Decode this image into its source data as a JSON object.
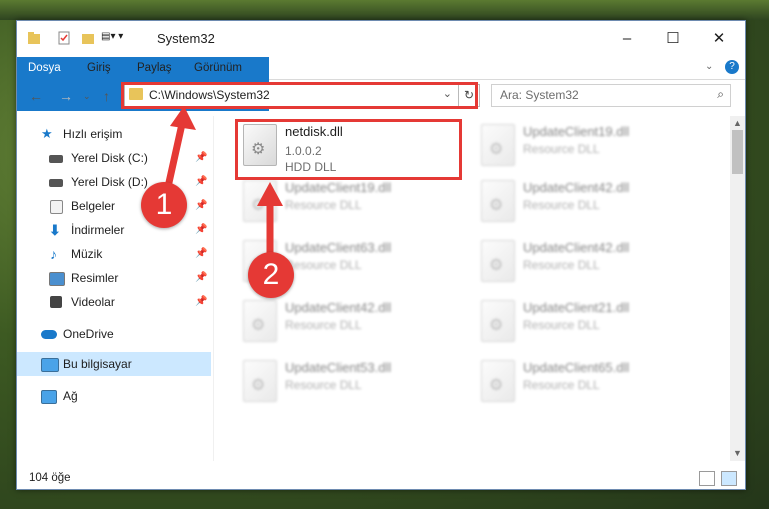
{
  "window": {
    "title": "System32"
  },
  "ribbon": {
    "tabs": [
      "Dosya",
      "Giriş",
      "Paylaş",
      "Görünüm"
    ]
  },
  "address": {
    "path": "C:\\Windows\\System32",
    "search_placeholder": "Ara: System32"
  },
  "sidebar": {
    "items": [
      {
        "label": "Hızlı erişim",
        "icon": "star-icon"
      },
      {
        "label": "Yerel Disk (C:)",
        "icon": "drive-icon",
        "pinned": true
      },
      {
        "label": "Yerel Disk (D:)",
        "icon": "drive-icon",
        "pinned": true
      },
      {
        "label": "Belgeler",
        "icon": "documents-icon",
        "pinned": true
      },
      {
        "label": "İndirmeler",
        "icon": "download-icon",
        "pinned": true
      },
      {
        "label": "Müzik",
        "icon": "music-icon",
        "pinned": true
      },
      {
        "label": "Resimler",
        "icon": "pictures-icon",
        "pinned": true
      },
      {
        "label": "Videolar",
        "icon": "videos-icon",
        "pinned": true
      },
      {
        "label": "OneDrive",
        "icon": "cloud-icon"
      },
      {
        "label": "Bu bilgisayar",
        "icon": "computer-icon",
        "selected": true
      },
      {
        "label": "Ağ",
        "icon": "network-icon"
      }
    ]
  },
  "files": {
    "highlighted": {
      "name": "netdisk.dll",
      "version": "1.0.0.2",
      "description": "HDD DLL"
    },
    "others": [
      {
        "name": "UpdateClient19.dll",
        "description": "Resource DLL"
      },
      {
        "name": "UpdateClient19.dll",
        "description": "Resource DLL"
      },
      {
        "name": "UpdateClient42.dll",
        "description": "Resource DLL"
      },
      {
        "name": "UpdateClient63.dll",
        "description": "Resource DLL"
      },
      {
        "name": "UpdateClient42.dll",
        "description": "Resource DLL"
      },
      {
        "name": "UpdateClient42.dll",
        "description": "Resource DLL"
      },
      {
        "name": "UpdateClient21.dll",
        "description": "Resource DLL"
      },
      {
        "name": "UpdateClient53.dll",
        "description": "Resource DLL"
      },
      {
        "name": "UpdateClient65.dll",
        "description": "Resource DLL"
      }
    ]
  },
  "status": {
    "item_count": "104 öğe"
  },
  "callouts": [
    "1",
    "2"
  ],
  "colors": {
    "accent": "#1979ca",
    "highlight": "#e53935",
    "selected": "#cce8ff"
  }
}
